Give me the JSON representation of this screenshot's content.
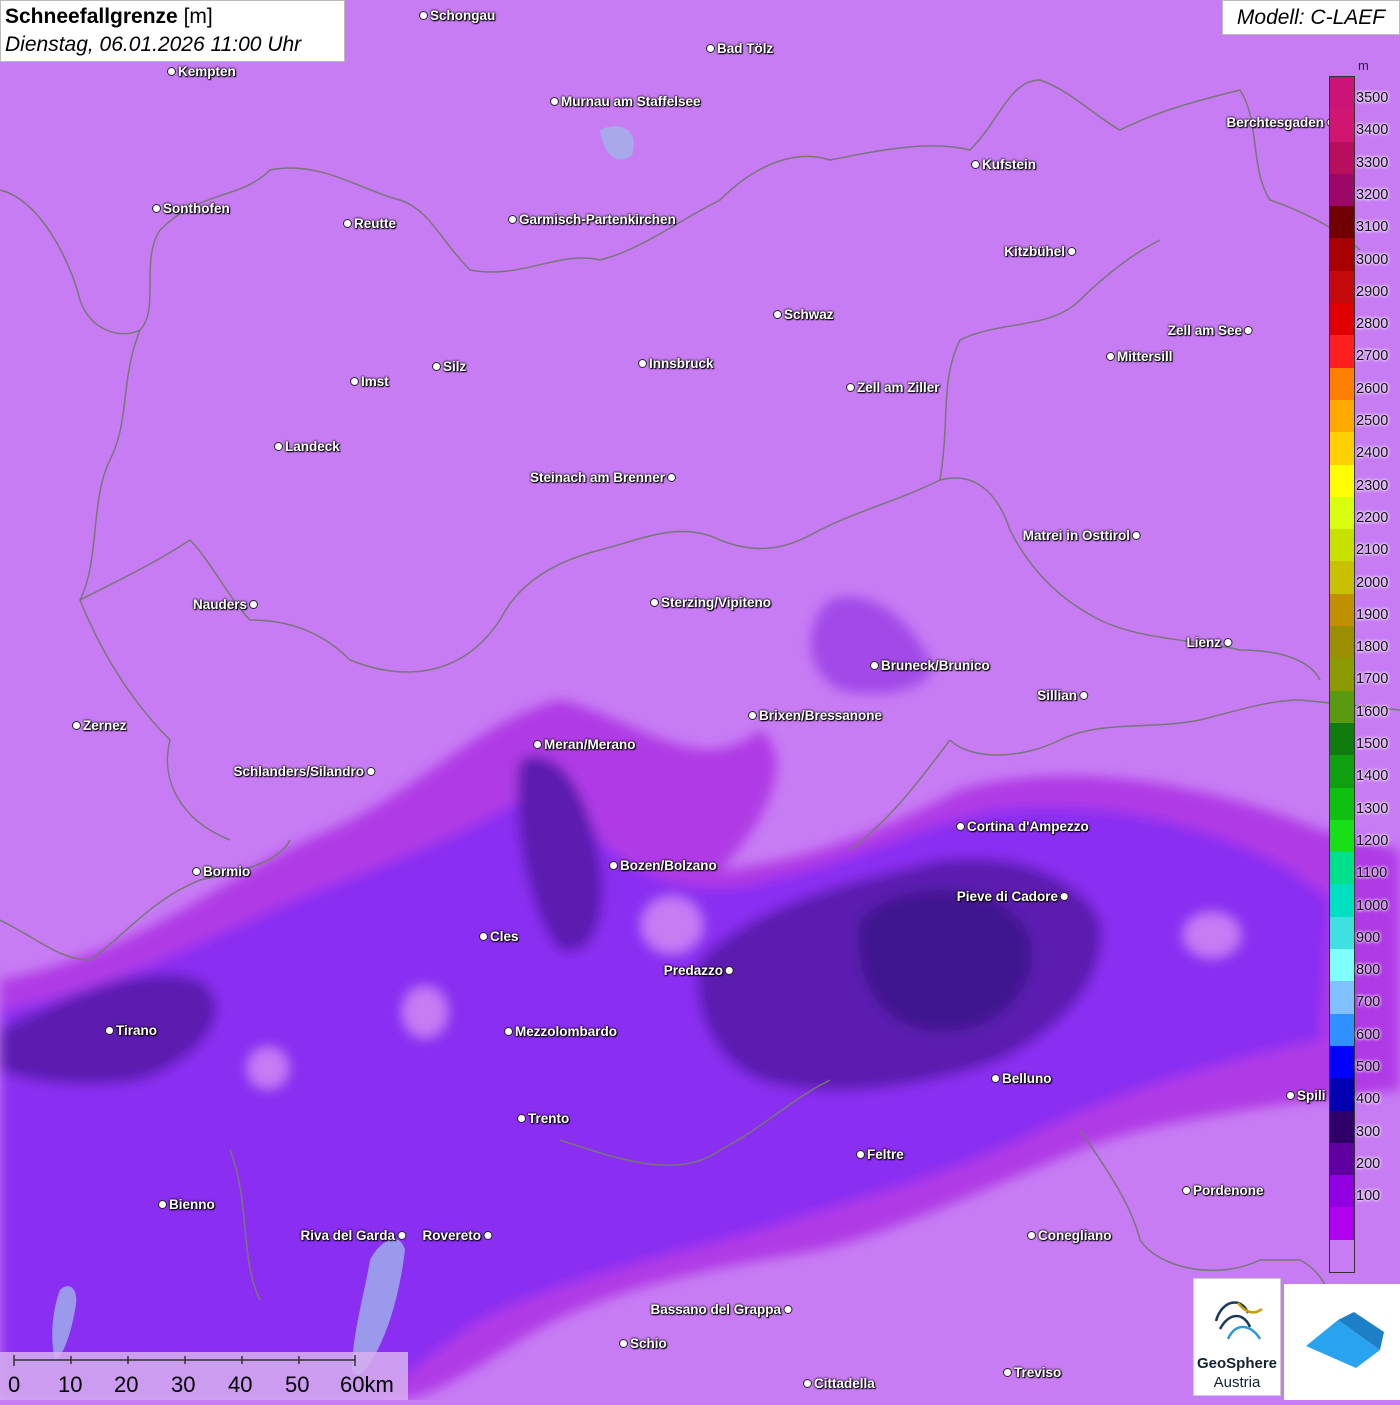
{
  "header": {
    "title_bold": "Schneefallgrenze",
    "title_unit": " [m]",
    "datetime": "Dienstag, 06.01.2026 11:00 Uhr",
    "model": "Modell: C-LAEF"
  },
  "legend": {
    "unit": "m",
    "levels": [
      "3500",
      "3400",
      "3300",
      "3200",
      "3100",
      "3000",
      "2900",
      "2800",
      "2700",
      "2600",
      "2500",
      "2400",
      "2300",
      "2200",
      "2100",
      "2000",
      "1900",
      "1800",
      "1700",
      "1600",
      "1500",
      "1400",
      "1300",
      "1200",
      "1100",
      "1000",
      "900",
      "800",
      "700",
      "600",
      "500",
      "400",
      "300",
      "200",
      "100"
    ],
    "colors": [
      "#cc1477",
      "#d01670",
      "#b80e5e",
      "#9c0868",
      "#700000",
      "#a80000",
      "#c40a0a",
      "#e00000",
      "#ff1f1f",
      "#ff7f00",
      "#ffa800",
      "#ffd000",
      "#ffff00",
      "#d8ff10",
      "#c8e000",
      "#c8c000",
      "#c09000",
      "#9a8f00",
      "#8a9a00",
      "#5a9a10",
      "#107c10",
      "#109f10",
      "#10c010",
      "#18e018",
      "#00e08a",
      "#00e0c0",
      "#40e0e0",
      "#80ffff",
      "#80c0ff",
      "#3090ff",
      "#0000ff",
      "#0000b0",
      "#30006a",
      "#6000a0",
      "#9000e0",
      "#b000f0",
      "#c77cf4"
    ]
  },
  "cities": [
    {
      "name": "Schongau"
    },
    {
      "name": "Bad Tölz"
    },
    {
      "name": "Kempten"
    },
    {
      "name": "Murnau am Staffelsee"
    },
    {
      "name": "Berchtesgaden"
    },
    {
      "name": "Kufstein"
    },
    {
      "name": "Sonthofen"
    },
    {
      "name": "Reutte"
    },
    {
      "name": "Garmisch-Partenkirchen"
    },
    {
      "name": "Kitzbühel"
    },
    {
      "name": "Schwaz"
    },
    {
      "name": "Zell am See"
    },
    {
      "name": "Mittersill"
    },
    {
      "name": "Innsbruck"
    },
    {
      "name": "Silz"
    },
    {
      "name": "Imst"
    },
    {
      "name": "Zell am Ziller"
    },
    {
      "name": "Landeck"
    },
    {
      "name": "Steinach am Brenner"
    },
    {
      "name": "Matrei in Osttirol"
    },
    {
      "name": "Nauders"
    },
    {
      "name": "Sterzing/Vipiteno"
    },
    {
      "name": "Lienz"
    },
    {
      "name": "Bruneck/Brunico"
    },
    {
      "name": "Sillian"
    },
    {
      "name": "Zernez"
    },
    {
      "name": "Brixen/Bressanone"
    },
    {
      "name": "Meran/Merano"
    },
    {
      "name": "Schlanders/Silandro"
    },
    {
      "name": "Cortina d'Ampezzo"
    },
    {
      "name": "Bozen/Bolzano"
    },
    {
      "name": "Bormio"
    },
    {
      "name": "Pieve di Cadore"
    },
    {
      "name": "Cles"
    },
    {
      "name": "Predazzo"
    },
    {
      "name": "Tirano"
    },
    {
      "name": "Mezzolombardo"
    },
    {
      "name": "Belluno"
    },
    {
      "name": "Spili"
    },
    {
      "name": "Trento"
    },
    {
      "name": "Feltre"
    },
    {
      "name": "Pordenone"
    },
    {
      "name": "Bienno"
    },
    {
      "name": "Riva del Garda"
    },
    {
      "name": "Rovereto"
    },
    {
      "name": "Conegliano"
    },
    {
      "name": "Bassano del Grappa"
    },
    {
      "name": "Schio"
    },
    {
      "name": "Treviso"
    },
    {
      "name": "Cittadella"
    }
  ],
  "scale_bar": {
    "labels": [
      "0",
      "10",
      "20",
      "30",
      "40",
      "50",
      "60km"
    ]
  },
  "logo": {
    "line1": "GeoSphere",
    "line2": "Austria"
  }
}
